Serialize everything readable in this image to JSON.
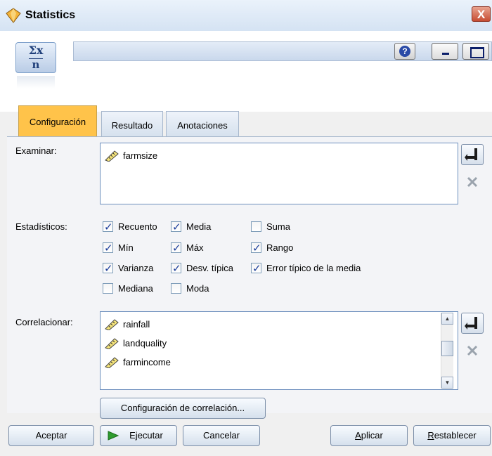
{
  "window": {
    "title": "Statistics",
    "close_label": "X"
  },
  "header": {
    "node_symbol_top": "Σx",
    "node_symbol_bottom": "n",
    "help_label": "?"
  },
  "tabs": [
    {
      "label": "Configuración",
      "active": true
    },
    {
      "label": "Resultado",
      "active": false
    },
    {
      "label": "Anotaciones",
      "active": false
    }
  ],
  "examine": {
    "label": "Examinar:",
    "fields": [
      "farmsize"
    ]
  },
  "statistics": {
    "label": "Estadísticos:",
    "options": [
      {
        "label": "Recuento",
        "checked": true
      },
      {
        "label": "Media",
        "checked": true
      },
      {
        "label": "Suma",
        "checked": false
      },
      {
        "label": "Mín",
        "checked": true
      },
      {
        "label": "Máx",
        "checked": true
      },
      {
        "label": "Rango",
        "checked": true
      },
      {
        "label": "Varianza",
        "checked": true
      },
      {
        "label": "Desv. típica",
        "checked": true
      },
      {
        "label": "Error típico de la media",
        "checked": true
      },
      {
        "label": "Mediana",
        "checked": false
      },
      {
        "label": "Moda",
        "checked": false
      }
    ]
  },
  "correlate": {
    "label": "Correlacionar:",
    "fields": [
      "rainfall",
      "landquality",
      "farmincome"
    ],
    "settings_button": "Configuración de correlación..."
  },
  "buttons": {
    "ok": "Aceptar",
    "run": "Ejecutar",
    "cancel": "Cancelar",
    "apply": "Aplicar",
    "reset": "Restablecer"
  },
  "colors": {
    "active_tab": "#ffc34a",
    "accent": "#1c3d9a"
  }
}
